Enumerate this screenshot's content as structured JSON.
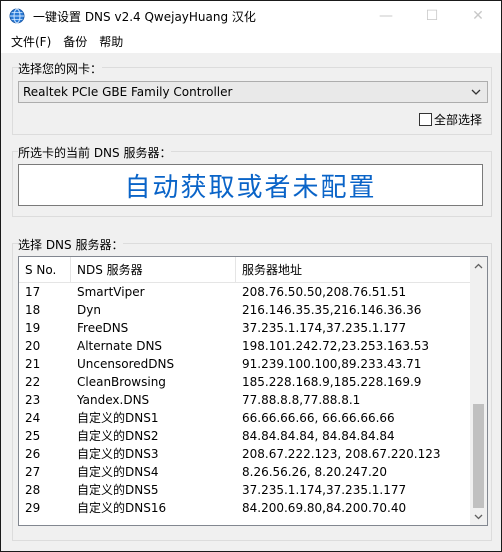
{
  "window": {
    "title": "一键设置 DNS v2.4 QwejayHuang 汉化",
    "minimize": "—",
    "maximize": "☐",
    "close": "✕"
  },
  "menu": {
    "file": "文件(F)",
    "backup": "备份",
    "help": "帮助"
  },
  "nic_group": {
    "label": "选择您的网卡：",
    "selected": "Realtek PCIe GBE Family Controller",
    "select_all": "全部选择"
  },
  "current_group": {
    "label": "所选卡的当前 DNS 服务器：",
    "value": "自动获取或者未配置"
  },
  "server_group": {
    "label": "选择 DNS 服务器：",
    "columns": [
      "S No.",
      "NDS 服务器",
      "服务器地址"
    ],
    "rows": [
      [
        "17",
        "SmartViper",
        "208.76.50.50,208.76.51.51"
      ],
      [
        "18",
        "Dyn",
        "216.146.35.35,216.146.36.36"
      ],
      [
        "19",
        "FreeDNS",
        "37.235.1.174,37.235.1.177"
      ],
      [
        "20",
        "Alternate DNS",
        "198.101.242.72,23.253.163.53"
      ],
      [
        "21",
        "UncensoredDNS",
        "91.239.100.100,89.233.43.71"
      ],
      [
        "22",
        "CleanBrowsing",
        "185.228.168.9,185.228.169.9"
      ],
      [
        "23",
        "Yandex.DNS",
        "77.88.8.8,77.88.8.1"
      ],
      [
        "24",
        "自定义的DNS1",
        "66.66.66.66, 66.66.66.66"
      ],
      [
        "25",
        "自定义的DNS2",
        "84.84.84.84, 84.84.84.84"
      ],
      [
        "26",
        "自定义的DNS3",
        "208.67.222.123, 208.67.220.123"
      ],
      [
        "27",
        "自定义的DNS4",
        "8.26.56.26, 8.20.247.20"
      ],
      [
        "28",
        "自定义的DNS5",
        "37.235.1.174,37.235.1.177"
      ],
      [
        "29",
        "自定义的DNS16",
        "84.200.69.80,84.200.70.40"
      ]
    ]
  },
  "colors": {
    "accent": "#0a64c8",
    "app_icon": "#2b7bd6"
  }
}
